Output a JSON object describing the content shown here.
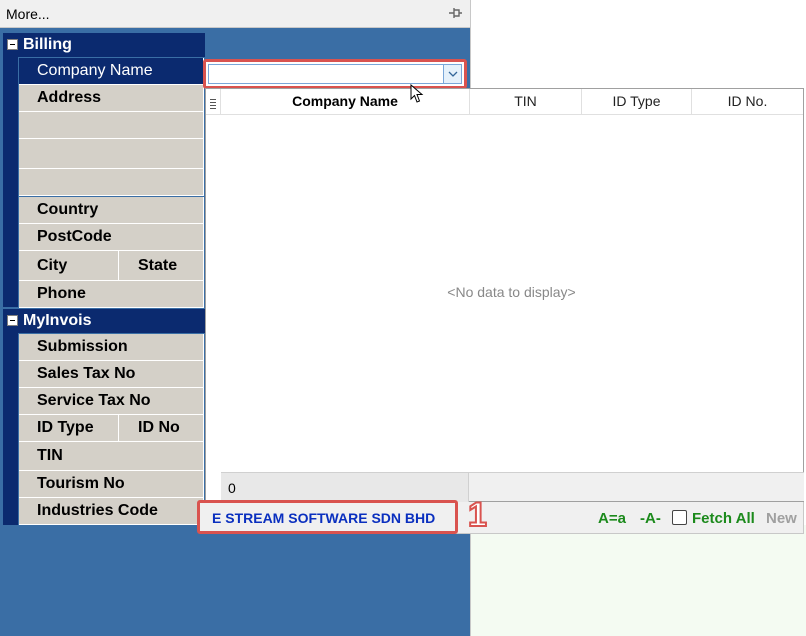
{
  "toolbar": {
    "more_label": "More...",
    "pin_icon": "pin-icon"
  },
  "billing": {
    "header": "Billing",
    "fields": {
      "company_name": "Company Name",
      "address": "Address",
      "country": "Country",
      "postcode": "PostCode",
      "city": "City",
      "state": "State",
      "phone": "Phone"
    }
  },
  "myinvois": {
    "header": "MyInvois",
    "fields": {
      "submission": "Submission",
      "sales_tax_no": "Sales Tax No",
      "service_tax_no": "Service Tax No",
      "id_type": "ID Type",
      "id_no": "ID No",
      "tin": "TIN",
      "tourism_no": "Tourism No",
      "industries_code": "Industries Code"
    }
  },
  "combo": {
    "value": ""
  },
  "grid": {
    "columns": [
      "Company Name",
      "TIN",
      "ID Type",
      "ID No."
    ],
    "empty_text": "<No data to display>",
    "row_count": "0"
  },
  "status": {
    "company": "E STREAM SOFTWARE SDN BHD",
    "callout": "1",
    "case_toggle": "A=a",
    "partial_toggle": "-A-",
    "fetch_all": "Fetch All",
    "new_label": "New"
  },
  "colors": {
    "panel_blue": "#3a6ea5",
    "header_navy": "#0b2a6f",
    "field_gray": "#d4d0c8",
    "highlight_red": "#d9534f",
    "company_blue": "#0a2fbf",
    "toggle_green": "#1c8a1c"
  }
}
